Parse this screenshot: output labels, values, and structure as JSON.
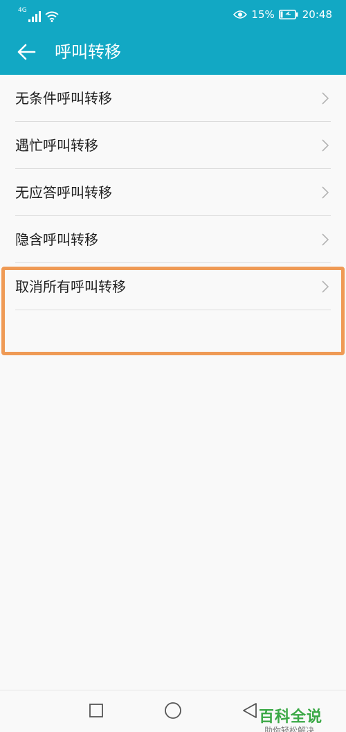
{
  "status_bar": {
    "network_type": "4G",
    "battery_percent": "15%",
    "time": "20:48",
    "battery_level": 0.15
  },
  "app_bar": {
    "title": "呼叫转移",
    "back_icon": "arrow-left-icon"
  },
  "call_forwarding_items": [
    {
      "label": "无条件呼叫转移"
    },
    {
      "label": "遇忙呼叫转移"
    },
    {
      "label": "无应答呼叫转移"
    },
    {
      "label": "隐含呼叫转移"
    },
    {
      "label": "取消所有呼叫转移"
    }
  ],
  "nav_bar": {
    "buttons": [
      "square-recents-icon",
      "circle-home-icon",
      "triangle-back-icon"
    ]
  },
  "watermark": {
    "logo": "百科全说",
    "subtitle": "助你轻松解决"
  },
  "colors": {
    "primary": "#12a8c4",
    "highlight": "#ef9a55",
    "background": "#f9f9f9",
    "watermark": "#3aa845"
  }
}
